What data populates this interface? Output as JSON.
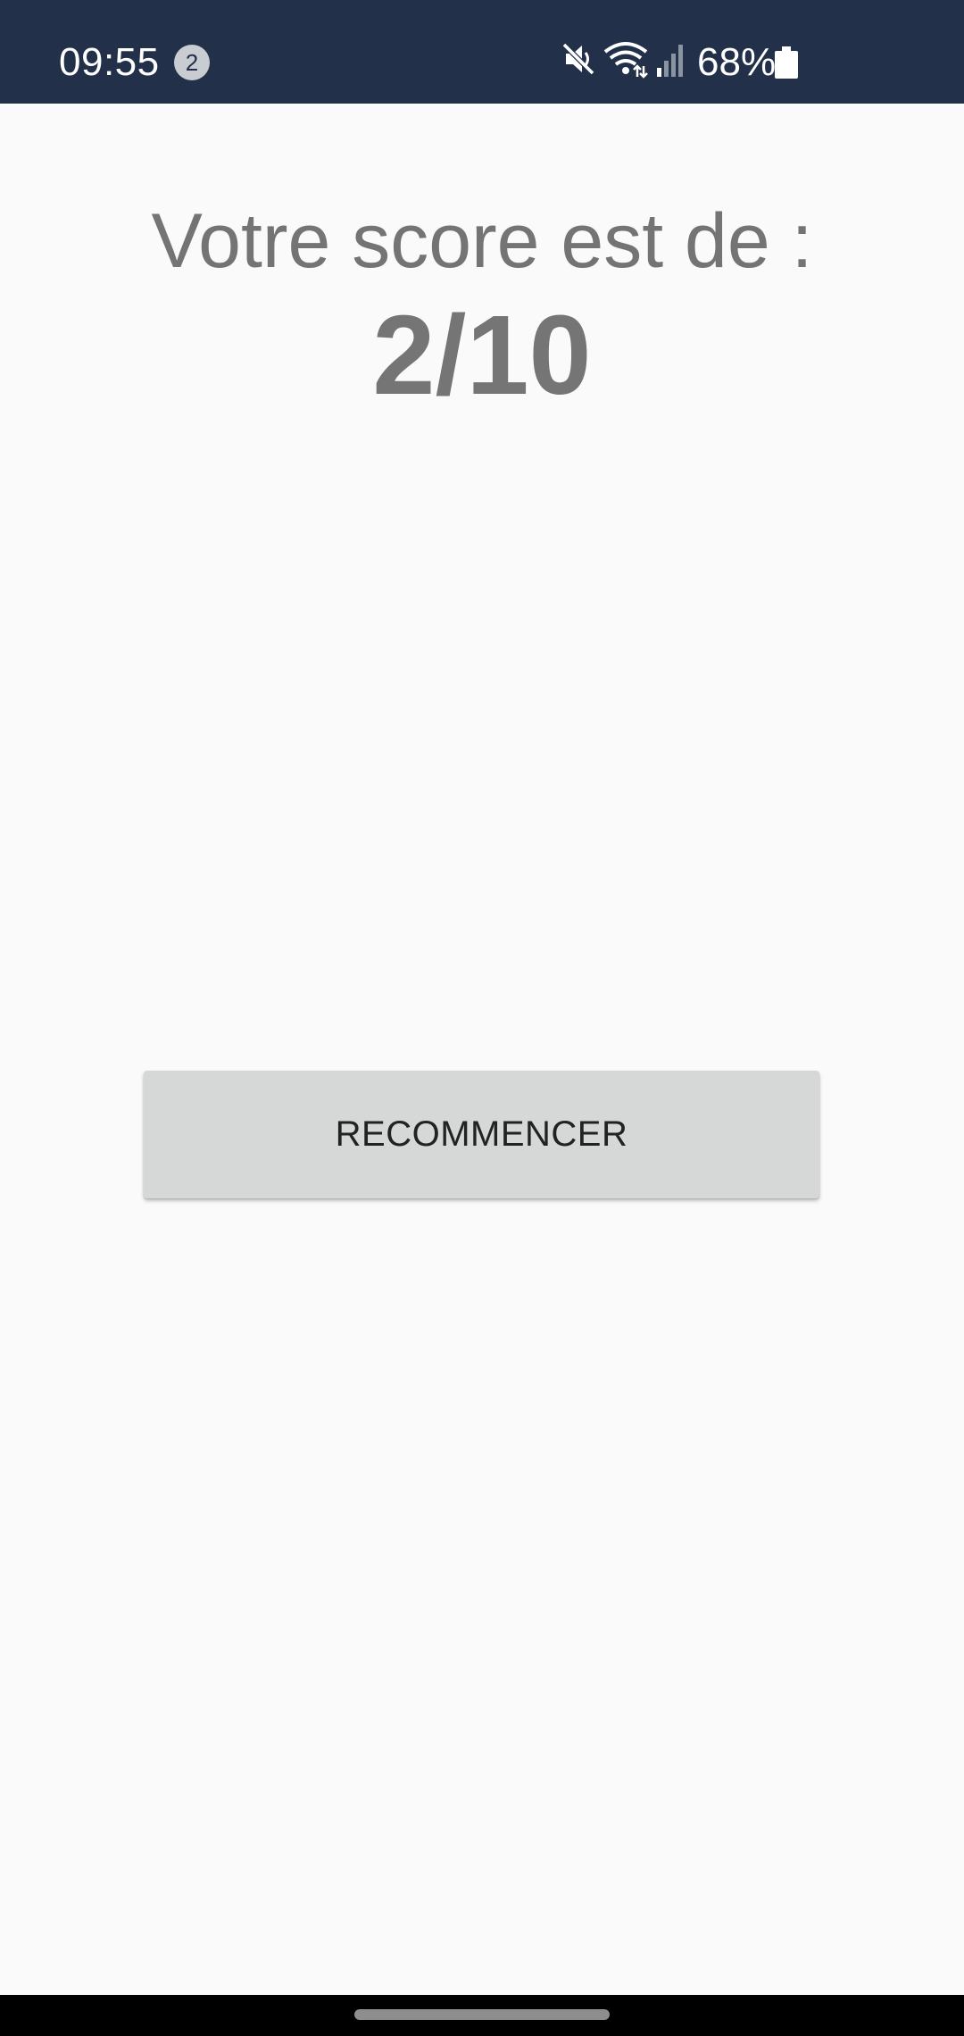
{
  "status_bar": {
    "time": "09:55",
    "notification_count": "2",
    "battery_percent": "68%",
    "icons": [
      "mute-icon",
      "wifi-icon",
      "cell-signal-icon",
      "battery-icon"
    ],
    "background_color": "#223149"
  },
  "main": {
    "score_label": "Votre score est de :",
    "score_value": "2/10",
    "restart_button_label": "RECOMMENCER"
  },
  "colors": {
    "page_background": "#fafafa",
    "text_gray": "#757575",
    "button_background": "#d6d7d7"
  }
}
